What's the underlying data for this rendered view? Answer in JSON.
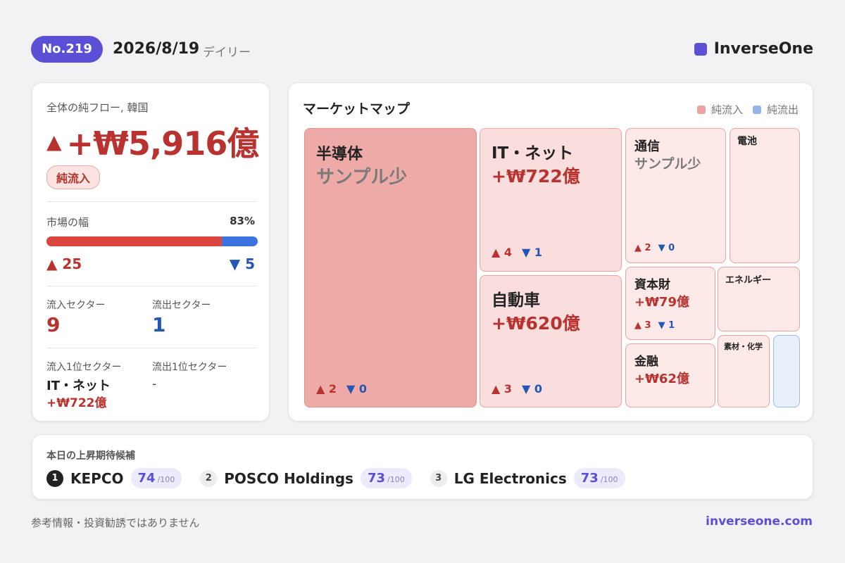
{
  "header": {
    "issue": "No.219",
    "date": "2026/8/19",
    "period": "デイリー",
    "brand": "InverseOne"
  },
  "summary": {
    "flow_label": "全体の純フロー, 韓国",
    "flow_arrow": "▲",
    "flow_value": "+₩5,916億",
    "flow_badge": "純流入",
    "breadth_label": "市場の幅",
    "breadth_pct_text": "83%",
    "breadth_fraction": 0.83,
    "advancers": "▲ 25",
    "decliners": "▼ 5",
    "inflow_sectors_label": "流入セクター",
    "inflow_sectors": "9",
    "outflow_sectors_label": "流出セクター",
    "outflow_sectors": "1",
    "top_inflow_label": "流入1位セクター",
    "top_inflow_name": "IT・ネット",
    "top_inflow_value": "+₩722億",
    "top_outflow_label": "流出1位セクター",
    "top_outflow_name": "-"
  },
  "market_map": {
    "title": "マーケットマップ",
    "legend_inflow": "純流入",
    "legend_outflow": "純流出",
    "colors": {
      "inflow": "#eca3a1",
      "outflow": "#94b5ea"
    },
    "tiles": [
      {
        "name": "半導体",
        "value": "サンプル少",
        "up": "▲ 2",
        "down": "▼ 0"
      },
      {
        "name": "IT・ネット",
        "value": "+₩722億",
        "up": "▲ 4",
        "down": "▼ 1"
      },
      {
        "name": "自動車",
        "value": "+₩620億",
        "up": "▲ 3",
        "down": "▼ 0"
      },
      {
        "name": "通信",
        "value": "サンプル少",
        "up": "▲ 2",
        "down": "▼ 0"
      },
      {
        "name": "電池"
      },
      {
        "name": "資本財",
        "value": "+₩79億",
        "up": "▲ 3",
        "down": "▼ 1"
      },
      {
        "name": "エネルギー"
      },
      {
        "name": "金融",
        "value": "+₩62億"
      },
      {
        "name": "素材・化学"
      },
      {
        "name": ""
      }
    ]
  },
  "candidates": {
    "title": "本日の上昇期待候補",
    "items": [
      {
        "rank": "1",
        "name": "KEPCO",
        "score": "74",
        "max": "/100"
      },
      {
        "rank": "2",
        "name": "POSCO Holdings",
        "score": "73",
        "max": "/100"
      },
      {
        "rank": "3",
        "name": "LG Electronics",
        "score": "73",
        "max": "/100"
      }
    ]
  },
  "footer": {
    "disclaimer": "参考情報・投資勧誘ではありません",
    "site": "inverseone.com"
  }
}
